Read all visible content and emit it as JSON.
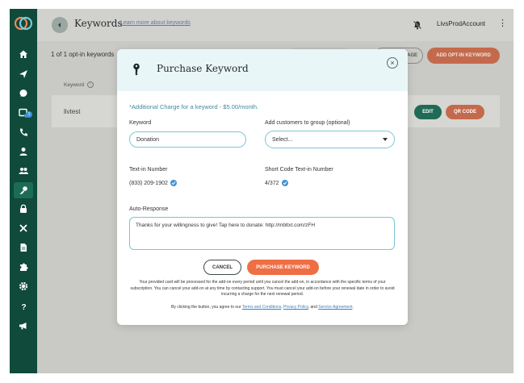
{
  "topbar": {
    "title": "Keywords",
    "learn_link": "Learn more about keywords",
    "account": "LivsProdAccount"
  },
  "background": {
    "count_text": "1 of 1 opt-in keywords",
    "partial_button": "AGE",
    "add_optin_button": "ADD OPT-IN KEYWORD",
    "column_header": "Keyword",
    "row_name": "livtest",
    "edit_button": "EDIT",
    "qr_button": "QR CODE"
  },
  "sidebar": {
    "badge": "1",
    "items": [
      "home-icon",
      "send-icon",
      "chat-icon",
      "inbox-icon",
      "phone-icon",
      "person-icon",
      "group-icon",
      "key-icon",
      "lock-icon",
      "tools-icon",
      "document-icon",
      "puzzle-icon",
      "settings-icon",
      "help-icon",
      "megaphone-icon"
    ]
  },
  "modal": {
    "title": "Purchase Keyword",
    "charge_note": "*Additional Charge for a keyword - $5.00/month.",
    "keyword_label": "Keyword",
    "keyword_value": "Donation",
    "group_label": "Add customers to group (optional)",
    "group_value": "Select...",
    "textin_label": "Text-in Number",
    "textin_value": "(833) 209-1902",
    "shortcode_label": "Short Code Text-in Number",
    "shortcode_value": "4/372",
    "autoresponse_label": "Auto-Response",
    "autoresponse_value": "Thanks for your willingness to give! Tap here to donate: http://mbltxt.com/zFH",
    "cancel_label": "CANCEL",
    "purchase_label": "PURCHASE KEYWORD",
    "disclaimer": "Your provided card will be processed for the add-on every period until you cancel the add-on, in accordance with the specific terms of your subscription. You can cancel your add-on at any time by contacting support. You must cancel your add-on before your renewal date in order to avoid incurring a charge for the next renewal period.",
    "agree_prefix": "By clicking the button, you agree to our",
    "terms_link": "Terms and Conditions",
    "agree_sep1": ",",
    "privacy_link": "Privacy Policy",
    "agree_sep2": ", and",
    "service_link": "Service Agreement",
    "agree_suffix": "."
  },
  "colors": {
    "sidebar": "#0f4a3a",
    "accent_orange": "#ee6f45",
    "accent_teal": "#3e8a98",
    "edit_green": "#1f6b56"
  }
}
